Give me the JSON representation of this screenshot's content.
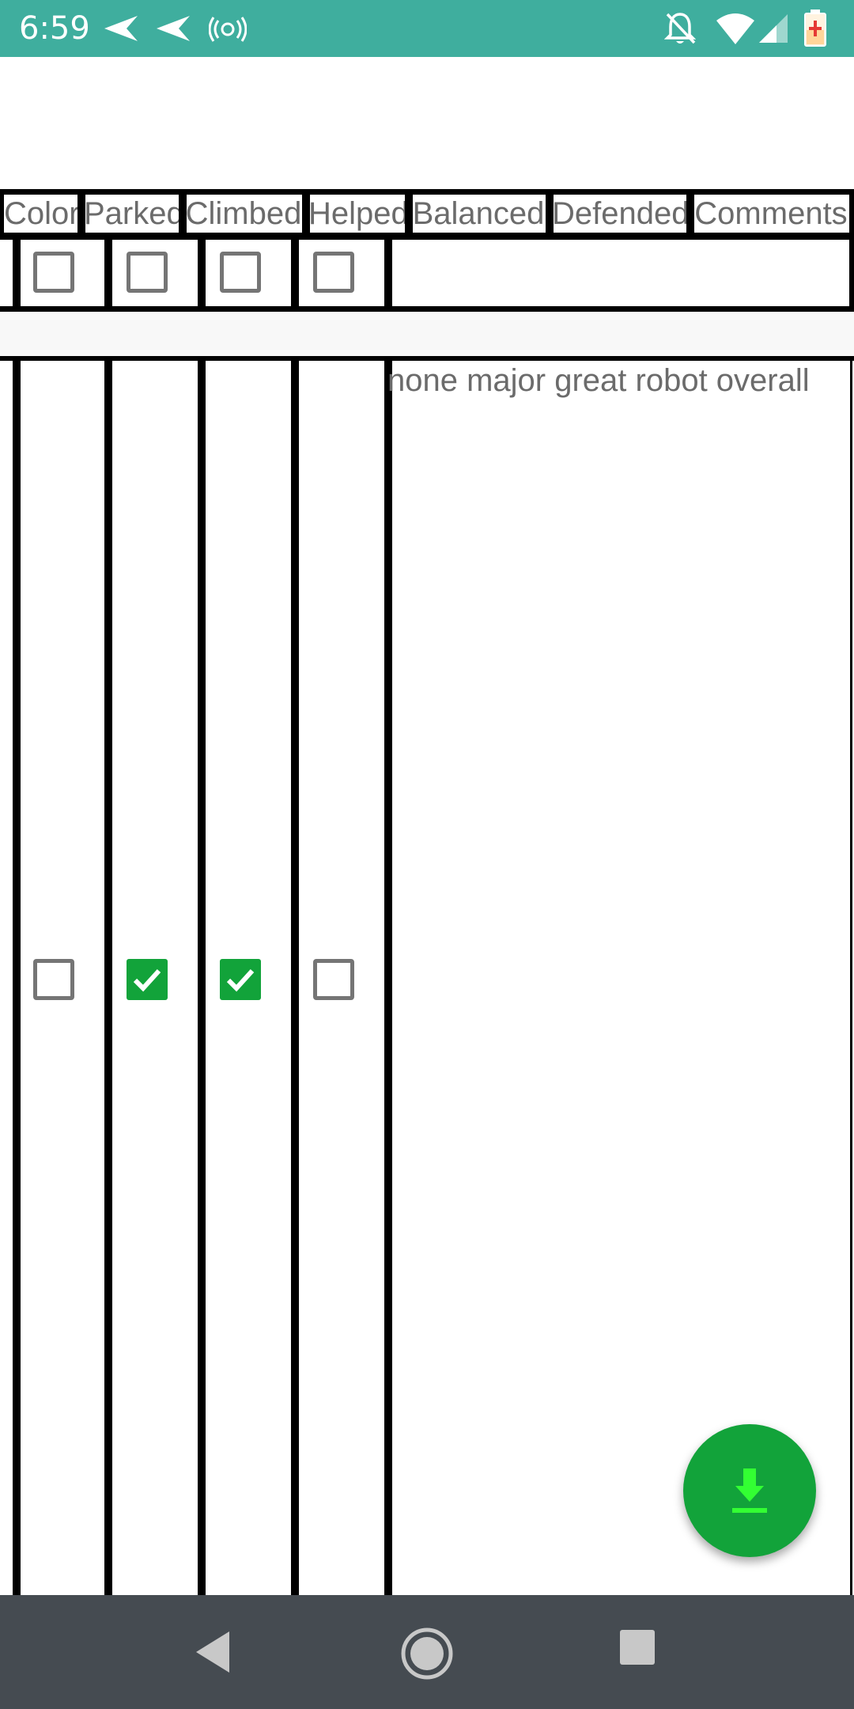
{
  "status_bar": {
    "time": "6:59",
    "icons_left": [
      "send-icon",
      "send-icon",
      "broadcast-icon"
    ],
    "icons_right": [
      "notifications-off-icon",
      "wifi-icon",
      "signal-icon",
      "battery-charging-icon"
    ],
    "color": "#3fae9e"
  },
  "table": {
    "headers": [
      "Color",
      "Parked",
      "Climbed",
      "Helped",
      "Balanced",
      "Defended",
      "Comments"
    ],
    "rows": [
      {
        "color": false,
        "parked": false,
        "climbed": false,
        "helped": false,
        "comments": ""
      },
      {
        "color": false,
        "parked": true,
        "climbed": true,
        "helped": false,
        "comments": "none major great robot overall"
      }
    ]
  },
  "fab": {
    "icon": "download-icon",
    "color": "#12a33a",
    "icon_color": "#33ff33"
  },
  "nav_bar": {
    "buttons": [
      "back-icon",
      "home-icon",
      "recents-icon"
    ]
  }
}
